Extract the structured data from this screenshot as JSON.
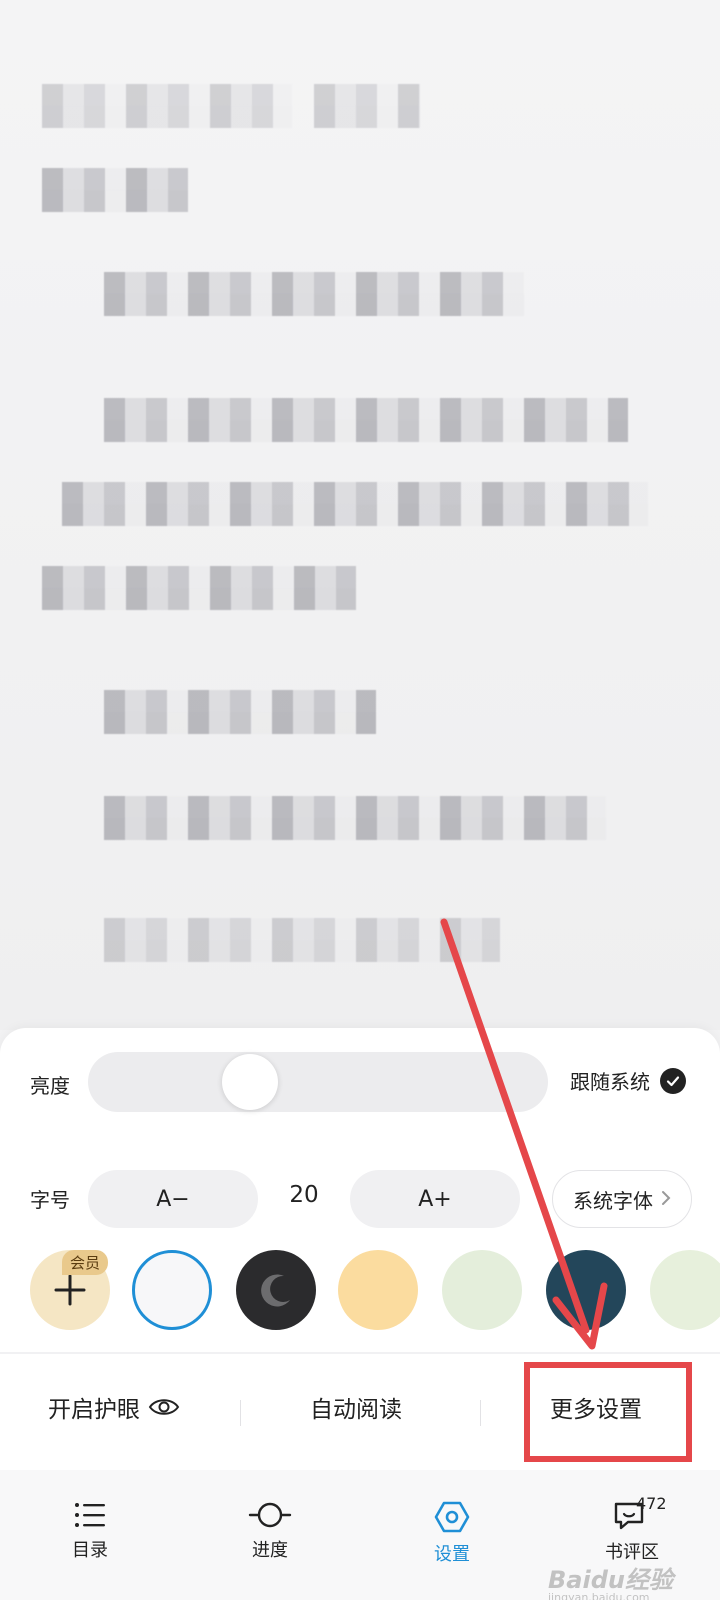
{
  "settings": {
    "brightness": {
      "label": "亮度",
      "level": 0.33,
      "follow_system_label": "跟随系统",
      "follow_system_checked": true
    },
    "font_size": {
      "label": "字号",
      "decrease_label": "A−",
      "value": "20",
      "increase_label": "A+",
      "font_family_label": "系统字体"
    },
    "themes": {
      "vip_badge": "会员",
      "colors": [
        "#f5e6c4",
        "#f7f7f9",
        "#2b2b2d",
        "#fbdc9f",
        "#e4eedb",
        "#23465a",
        "#e7f0dc"
      ],
      "selected_index": 1
    },
    "actions": {
      "eye_care_label": "开启护眼",
      "auto_read_label": "自动阅读",
      "more_settings_label": "更多设置"
    }
  },
  "bottom_nav": {
    "items": [
      {
        "label": "目录"
      },
      {
        "label": "进度"
      },
      {
        "label": "设置"
      },
      {
        "label": "书评区"
      }
    ],
    "active_index": 2,
    "comment_count": "472"
  },
  "colors": {
    "accent": "#1f8fd6",
    "highlight": "#e5474a"
  },
  "watermark": {
    "text": "Baidu经验",
    "sub": "jingyan.baidu.com"
  }
}
